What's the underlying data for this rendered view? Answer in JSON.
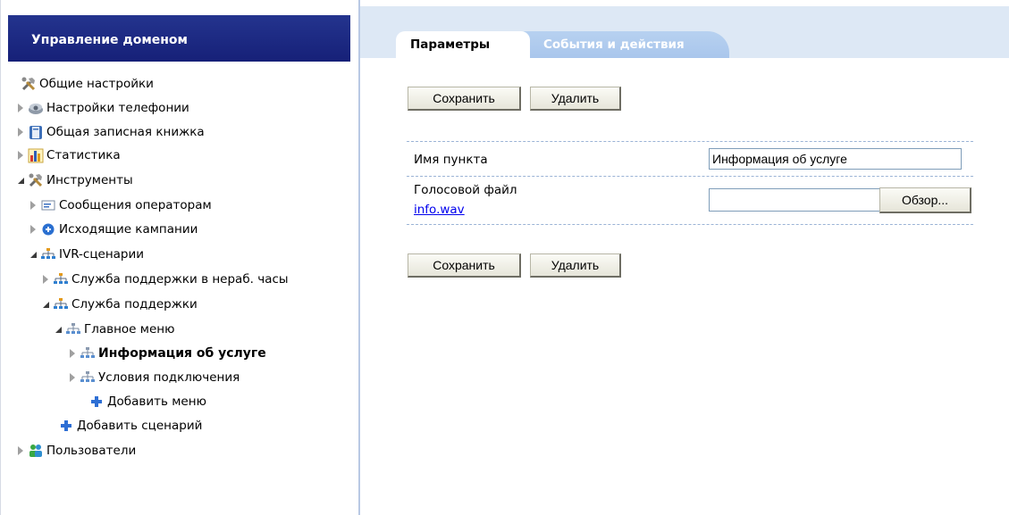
{
  "sidebar": {
    "title": "Управление доменом",
    "items": [
      {
        "label": "Общие настройки",
        "icon": "tools-icon"
      },
      {
        "label": "Настройки телефонии",
        "icon": "telephone-icon"
      },
      {
        "label": "Общая записная книжка",
        "icon": "address-book-icon"
      },
      {
        "label": "Статистика",
        "icon": "statistics-icon"
      },
      {
        "label": "Инструменты",
        "icon": "tools-icon"
      },
      {
        "label": "Сообщения операторам",
        "icon": "message-icon"
      },
      {
        "label": "Исходящие кампании",
        "icon": "campaign-icon"
      },
      {
        "label": "IVR-сценарии",
        "icon": "ivr-tree-icon"
      },
      {
        "label": "Служба поддержки в нераб. часы",
        "icon": "ivr-tree-icon"
      },
      {
        "label": "Служба поддержки",
        "icon": "ivr-tree-icon"
      },
      {
        "label": "Главное меню",
        "icon": "menu-tree-icon"
      },
      {
        "label": "Информация об услуге",
        "icon": "menu-tree-icon"
      },
      {
        "label": "Условия подключения",
        "icon": "menu-tree-icon"
      },
      {
        "label": "Добавить меню",
        "icon": "plus-icon"
      },
      {
        "label": "Добавить сценарий",
        "icon": "plus-icon"
      },
      {
        "label": "Пользователи",
        "icon": "users-icon"
      }
    ]
  },
  "tabs": [
    {
      "label": "Параметры",
      "active": true
    },
    {
      "label": "События и действия",
      "active": false
    }
  ],
  "form": {
    "save_label": "Сохранить",
    "delete_label": "Удалить",
    "name_label": "Имя пункта",
    "name_value": "Информация об услуге",
    "voice_label": "Голосовой файл",
    "voice_link": "info.wav",
    "voice_value": "",
    "browse_label": "Обзор..."
  },
  "colors": {
    "header_bg": "#1c2880",
    "tab_strip": "#dde8f5",
    "tab_inactive": "#aac8ee",
    "dashed": "#9bb3d6"
  }
}
